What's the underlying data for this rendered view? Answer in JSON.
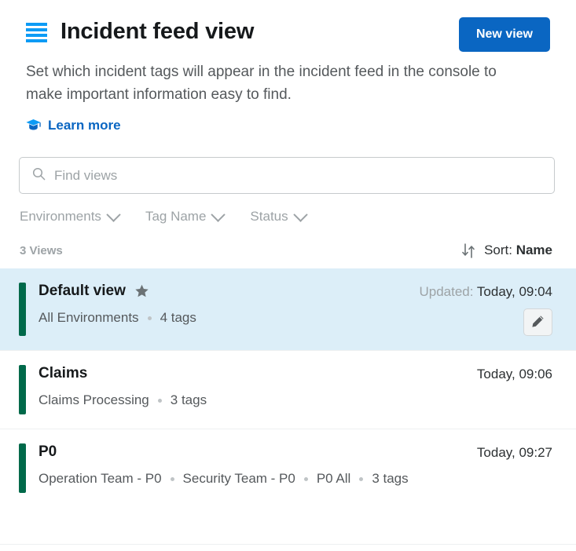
{
  "header": {
    "menu_icon": "hamburger-menu-icon",
    "title": "Incident feed view",
    "new_view_label": "New view",
    "accent_blue": "#0a66c2",
    "menu_icon_color": "#0d9bf5"
  },
  "description": {
    "text": "Set which incident tags will appear in the incident feed in the console to make important information easy to find.",
    "learn_more_label": "Learn more",
    "learn_more_icon": "graduation-cap-icon"
  },
  "search": {
    "icon": "search-icon",
    "placeholder": "Find views",
    "value": ""
  },
  "filters": [
    {
      "label": "Environments",
      "icon": "chevron-down-icon"
    },
    {
      "label": "Tag Name",
      "icon": "chevron-down-icon"
    },
    {
      "label": "Status",
      "icon": "chevron-down-icon"
    }
  ],
  "list_toolbar": {
    "count_label": "3 Views",
    "sort_icon": "sort-arrows-icon",
    "sort_prefix": "Sort: ",
    "sort_value": "Name"
  },
  "views": [
    {
      "name": "Default view",
      "starred": true,
      "star_icon": "star-filled-icon",
      "meta": [
        "All Environments",
        "4 tags"
      ],
      "date_label": "Updated: ",
      "date_value": "Today, 09:04",
      "selected": true,
      "edit_icon": "pencil-edit-icon",
      "edit_button": true,
      "bar_color": "#00694a"
    },
    {
      "name": "Claims",
      "starred": false,
      "meta": [
        "Claims Processing",
        "3 tags"
      ],
      "date_label": "",
      "date_value": "Today, 09:06",
      "selected": false,
      "edit_button": false,
      "bar_color": "#00694a"
    },
    {
      "name": "P0",
      "starred": false,
      "meta": [
        "Operation Team - P0",
        "Security Team - P0",
        "P0 All",
        "3 tags"
      ],
      "date_label": "",
      "date_value": "Today, 09:27",
      "selected": false,
      "edit_button": false,
      "bar_color": "#00694a"
    }
  ],
  "colors": {
    "selected_row_bg": "#dceef8",
    "bar_green": "#00694a",
    "primary_blue": "#0a66c2",
    "muted_text": "#9da3a6",
    "body_text": "#55595c"
  }
}
